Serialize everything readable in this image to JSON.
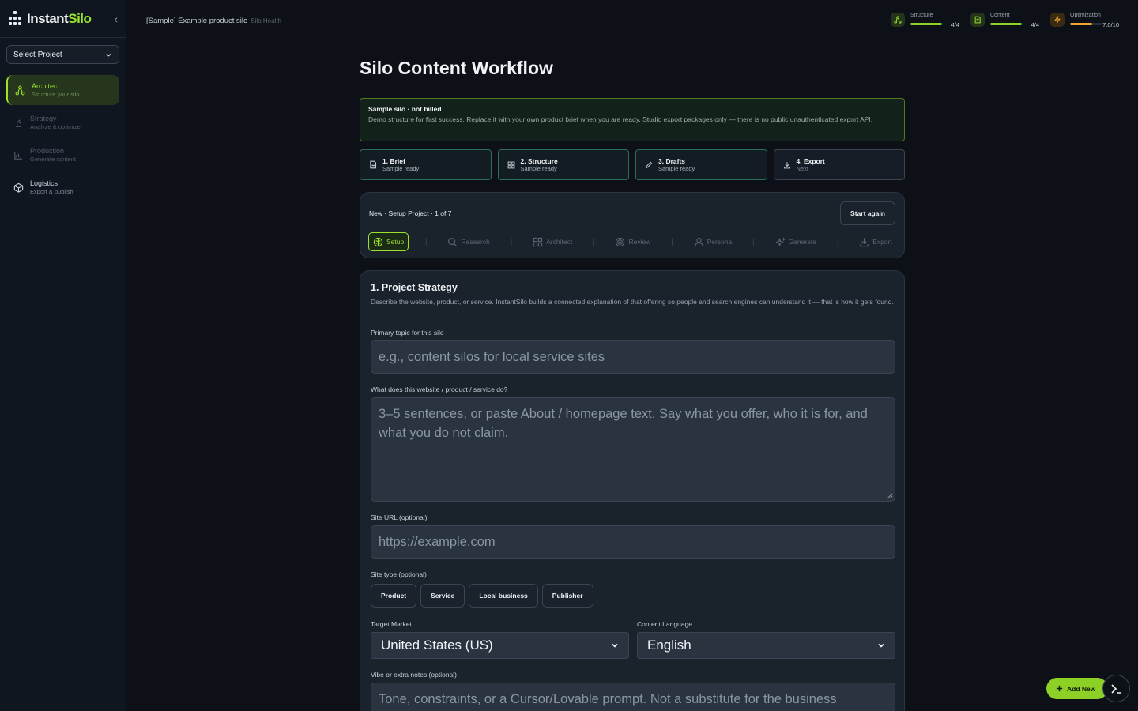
{
  "brand": {
    "name_part1": "Instant",
    "name_part2": "Silo"
  },
  "sidebar": {
    "select_project": "Select Project",
    "items": [
      {
        "label": "Architect",
        "sub": "Structure your silo",
        "icon": "architect-icon",
        "active": true
      },
      {
        "label": "Strategy",
        "sub": "Analyze & optimize",
        "icon": "strategy-icon"
      },
      {
        "label": "Production",
        "sub": "Generate content",
        "icon": "chart-icon"
      },
      {
        "label": "Logistics",
        "sub": "Export & publish",
        "icon": "box-icon"
      }
    ]
  },
  "header": {
    "breadcrumb": "[Sample] Example product silo",
    "health": "Silo Health",
    "metrics": [
      {
        "name": "Structure",
        "value": "4/4",
        "fraction": 1.0,
        "color": "#8ed126",
        "icon": "structure-icon"
      },
      {
        "name": "Content",
        "value": "4/4",
        "fraction": 1.0,
        "color": "#8ed126",
        "icon": "document-icon"
      },
      {
        "name": "Optimization",
        "value": "7.0/10",
        "fraction": 0.7,
        "color": "#f0a530",
        "icon": "bolt-icon"
      }
    ]
  },
  "main": {
    "title": "Silo Content Workflow",
    "notice": {
      "title": "Sample silo · not billed",
      "body": "Demo structure for first success. Replace it with your own product brief when you are ready. Studio export packages only — there is no public unauthenticated export API."
    },
    "steps": [
      {
        "label": "1. Brief",
        "sub": "Sample ready"
      },
      {
        "label": "2. Structure",
        "sub": "Sample ready"
      },
      {
        "label": "3. Drafts",
        "sub": "Sample ready"
      },
      {
        "label": "4. Export",
        "sub": "Next"
      }
    ],
    "wizard": {
      "meta": "New · Setup Project · 1 of 7",
      "start_again": "Start again",
      "tabs": [
        "Setup",
        "Research",
        "Architect",
        "Review",
        "Persona",
        "Generate",
        "Export"
      ]
    },
    "form": {
      "title": "1. Project Strategy",
      "desc": "Describe the website, product, or service. InstantSilo builds a connected explanation of that offering so people and search engines can understand it — that is how it gets found.",
      "topic_label": "Primary topic for this silo",
      "topic_placeholder": "e.g., content silos for local service sites",
      "about_label": "What does this website / product / service do?",
      "about_placeholder": "3–5 sentences, or paste About / homepage text. Say what you offer, who it is for, and what you do not claim.",
      "url_label": "Site URL (optional)",
      "url_placeholder": "https://example.com",
      "site_type_label": "Site type (optional)",
      "site_types": [
        "Product",
        "Service",
        "Local business",
        "Publisher"
      ],
      "market_label": "Target Market",
      "market_value": "United States (US)",
      "language_label": "Content Language",
      "language_value": "English",
      "vibe_label": "Vibe or extra notes (optional)",
      "vibe_placeholder": "Tone, constraints, or a Cursor/Lovable prompt. Not a substitute for the business description."
    }
  },
  "fab": {
    "add_new": "Add New"
  },
  "colors": {
    "accent": "#9be22d",
    "background": "#0d1117",
    "panel": "#1a222c"
  }
}
